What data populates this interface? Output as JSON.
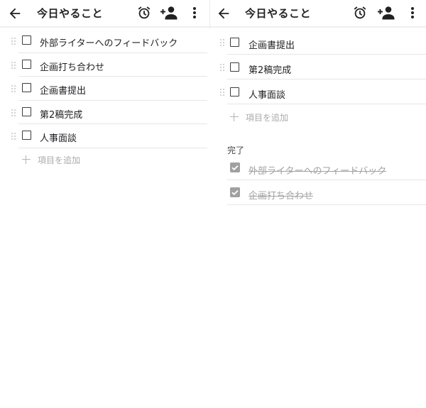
{
  "appbar": {
    "title": "今日やること",
    "icons": [
      "back-arrow-icon",
      "alarm-icon",
      "add-person-icon",
      "more-vert-icon"
    ]
  },
  "left": {
    "items": [
      {
        "label": "外部ライターへのフィードバック"
      },
      {
        "label": "企画打ち合わせ"
      },
      {
        "label": "企画書提出"
      },
      {
        "label": "第2稿完成"
      },
      {
        "label": "人事面談"
      }
    ],
    "add_label": "項目を追加"
  },
  "right": {
    "items": [
      {
        "label": "企画書提出"
      },
      {
        "label": "第2稿完成"
      },
      {
        "label": "人事面談"
      }
    ],
    "add_label": "項目を追加",
    "done_heading": "完了",
    "done_items": [
      {
        "label": "外部ライターへのフィードバック"
      },
      {
        "label": "企画打ち合わせ"
      }
    ]
  },
  "colors": {
    "text": "#202124",
    "muted": "#aaaaaa",
    "checked_box": "#a0a0a0",
    "divider": "#e6e6e6"
  }
}
